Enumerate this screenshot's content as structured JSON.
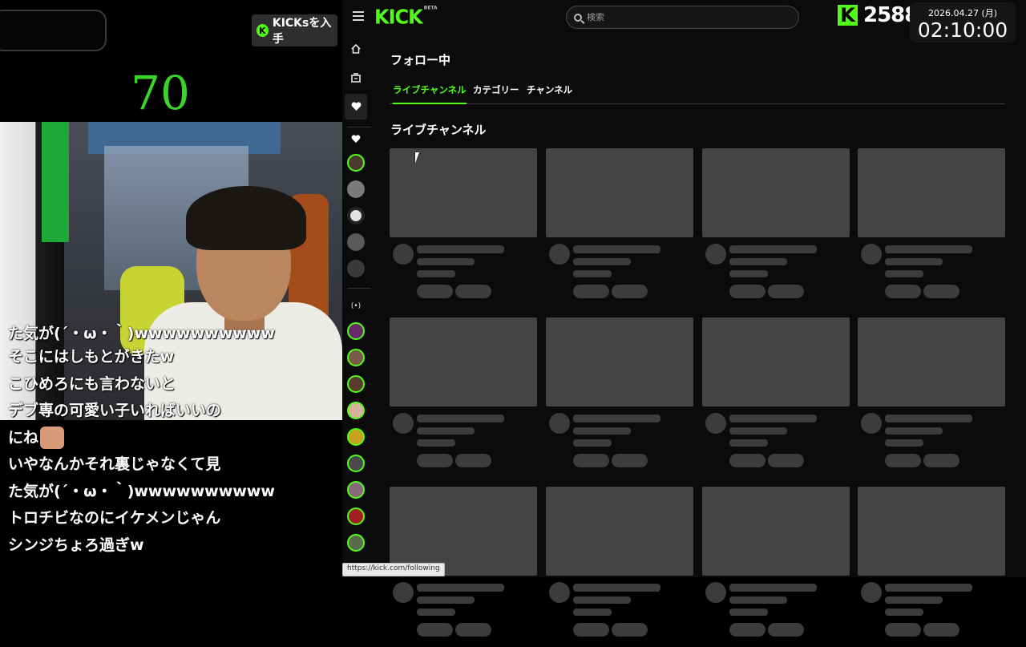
{
  "overlay": {
    "kicks_button_label": "KICKsを入手",
    "counter_value": "70",
    "chat_messages": [
      "た気が(´・ω・｀)wwwwwwwwww",
      "そこにはしもとがきたw",
      "こひめろにも言わないと",
      "デブ専の可愛い子いればいいの",
      "にね",
      "いやなんかそれ裏じゃなくて見",
      "た気が(´・ω・｀)wwwwwwwwww",
      "トロチビなのにイケメンじゃん",
      "シンジちょろ過ぎw"
    ],
    "kick_points": "2588",
    "clock_date": "2026.04.27 (月)",
    "clock_time": "02:10:00"
  },
  "header": {
    "logo_text": "KICK",
    "logo_badge": "BETA",
    "search_placeholder": "検索"
  },
  "main": {
    "page_title": "フォロー中",
    "tabs": [
      {
        "label": "ライブチャンネル",
        "active": true
      },
      {
        "label": "カテゴリー",
        "active": false
      },
      {
        "label": "チャンネル",
        "active": false
      }
    ],
    "section_title": "ライブチャンネル"
  },
  "sidebar": {
    "icons": [
      "home-icon",
      "browse-icon",
      "following-heart-icon"
    ],
    "followed_label_icon": "heart-icon",
    "live_label_icon": "live-broadcast-icon"
  },
  "status_bar": {
    "url": "https://kick.com/following"
  },
  "colors": {
    "accent": "#53fc18",
    "background": "#0b0b0c",
    "skeleton": "#444447",
    "counter_green": "#39d629"
  }
}
